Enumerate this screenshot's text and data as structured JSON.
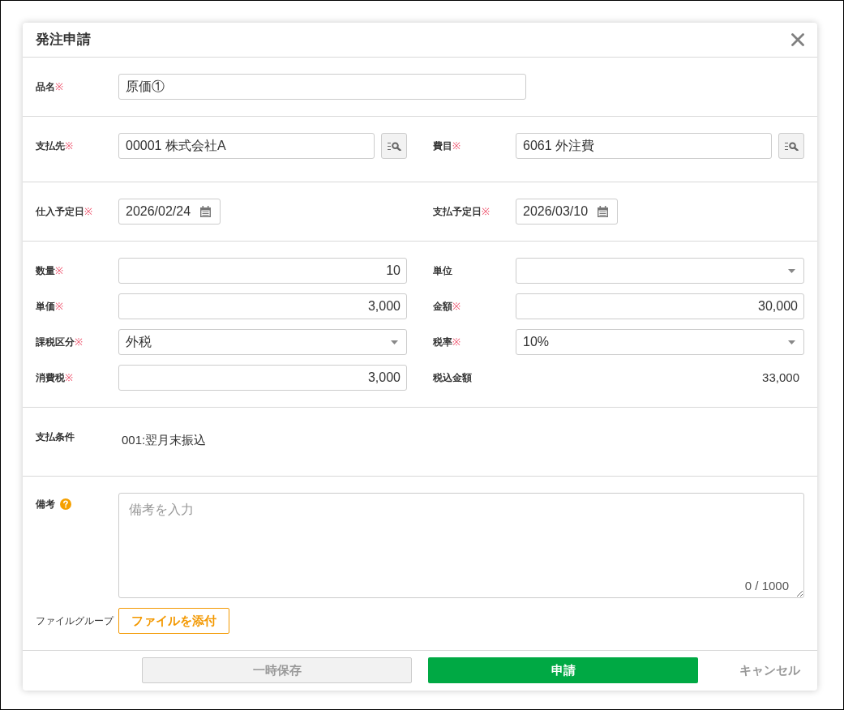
{
  "dialog": {
    "title": "発注申請"
  },
  "sections": [
    {
      "kind": "single",
      "fields": [
        {
          "kind": "text",
          "label": "品名",
          "required_mark": "※",
          "value": "原価①"
        }
      ]
    },
    {
      "kind": "pair",
      "fields": [
        {
          "kind": "lookup",
          "label": "支払先",
          "required_mark": "※",
          "value": "00001 株式会社A"
        },
        {
          "kind": "lookup",
          "label": "費目",
          "required_mark": "※",
          "value": "6061 外注費"
        }
      ]
    },
    {
      "kind": "pair",
      "fields": [
        {
          "kind": "date",
          "label": "仕入予定日",
          "required_mark": "※",
          "value": "2026/02/24"
        },
        {
          "kind": "date",
          "label": "支払予定日",
          "required_mark": "※",
          "value": "2026/03/10"
        }
      ]
    },
    {
      "kind": "pair",
      "fields": [
        {
          "kind": "number",
          "label": "数量",
          "required_mark": "※",
          "value": "10"
        },
        {
          "kind": "select",
          "label": "単位"
        },
        {
          "kind": "number",
          "label": "単価",
          "required_mark": "※",
          "value": "3,000"
        },
        {
          "kind": "number",
          "label": "金額",
          "required_mark": "※",
          "value": "30,000"
        },
        {
          "kind": "select",
          "label": "課税区分",
          "required_mark": "※",
          "value": "外税"
        },
        {
          "kind": "select",
          "label": "税率",
          "required_mark": "※",
          "value": "10%"
        },
        {
          "kind": "number",
          "label": "消費税",
          "required_mark": "※",
          "value": "3,000"
        },
        {
          "kind": "static",
          "label": "税込金額",
          "value": "33,000"
        }
      ]
    },
    {
      "kind": "single",
      "fields": [
        {
          "kind": "static",
          "label": "支払条件",
          "value": "001:翌月末振込"
        }
      ]
    }
  ],
  "notes": {
    "label": "備考",
    "placeholder": "備考を入力",
    "counter": "0 / 1000"
  },
  "attachment": {
    "label": "ファイルグループ",
    "button": "ファイルを添付"
  },
  "buttons": [
    {
      "kind": "secondary",
      "label": "一時保存",
      "disabled": true
    },
    {
      "kind": "primary",
      "label": "申請",
      "disabled": false
    },
    {
      "kind": "link",
      "label": "キャンセル",
      "disabled": false
    }
  ]
}
